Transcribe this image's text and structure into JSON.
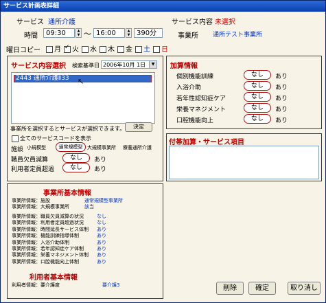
{
  "window": {
    "title": "サービス計画表詳細"
  },
  "header": {
    "service_label": "サービス",
    "service_value": "通所介護",
    "content_label": "サービス内容",
    "content_value": "未選択",
    "time_label": "時間",
    "start_time": "09:30",
    "tilde": "〜",
    "end_time": "16:00",
    "duration": "390分",
    "office_label": "事業所",
    "office_value": "通所テスト事業所",
    "weekday_copy_label": "曜日コピー",
    "weekdays": [
      {
        "label": "月",
        "checked": false,
        "color": "#000000"
      },
      {
        "label": "火",
        "checked": true,
        "color": "#000000"
      },
      {
        "label": "水",
        "checked": false,
        "color": "#000000"
      },
      {
        "label": "木",
        "checked": false,
        "color": "#000000"
      },
      {
        "label": "金",
        "checked": false,
        "color": "#000000"
      },
      {
        "label": "土",
        "checked": false,
        "color": "#0033cc"
      },
      {
        "label": "日",
        "checked": false,
        "color": "#d00000"
      }
    ]
  },
  "service_select": {
    "title": "サービス内容選択",
    "search_date_label": "検索基準日",
    "search_date_value": "2006年10月 1日",
    "selected_item": "2443 通所介護Ⅱ33",
    "hint": "事業所を選択するとサービスが選択できます。",
    "decide_button": "決定",
    "show_all_label": "全てのサービスコードを表示",
    "facility_label": "施設",
    "facility_options": [
      "小規模型",
      "通常規模型",
      "大規模事業所",
      "療養通所介護"
    ],
    "staff_shortage_label": "職員欠員減算",
    "over_capacity_label": "利用者定員超過",
    "nashi": "なし",
    "ari": "あり"
  },
  "addition": {
    "title": "加算情報",
    "items": [
      {
        "label": "個別機能訓練",
        "value": "なし",
        "alt": "あり"
      },
      {
        "label": "入浴介助",
        "value": "なし",
        "alt": "あり"
      },
      {
        "label": "若年性認知症ケア",
        "value": "なし",
        "alt": "あり"
      },
      {
        "label": "栄養マネジメント",
        "value": "なし",
        "alt": "あり"
      },
      {
        "label": "口腔機能向上",
        "value": "なし",
        "alt": "あり"
      }
    ]
  },
  "extra": {
    "title": "付帯加算・サービス項目"
  },
  "office_info": {
    "title": "事業所基本情報",
    "rows": [
      {
        "label": "事業所情報：施設",
        "value": "通常規模型事業所"
      },
      {
        "label": "事業所情報：大規模事業所",
        "value": "該当"
      },
      {
        "label": "事業所情報：職員欠員減算の状況",
        "value": "なし"
      },
      {
        "label": "事業所情報：利用者定員超過状況",
        "value": "なし"
      },
      {
        "label": "事業所情報：時間延長サービス体制",
        "value": "あり"
      },
      {
        "label": "事業所情報：機能訓練指導体制",
        "value": "あり"
      },
      {
        "label": "事業所情報：入浴介助体制",
        "value": "あり"
      },
      {
        "label": "事業所情報：若年認知症ケア体制",
        "value": "あり"
      },
      {
        "label": "事業所情報：栄養マネジメント体制",
        "value": "あり"
      },
      {
        "label": "事業所情報：口腔機能向上体制",
        "value": "あり"
      }
    ]
  },
  "user_info": {
    "title": "利用者基本情報",
    "label": "利用者情報：要介護度",
    "value": "要介護3"
  },
  "footer": {
    "delete_button": "削除",
    "confirm_button": "確定",
    "cancel_button": "取り消し"
  }
}
